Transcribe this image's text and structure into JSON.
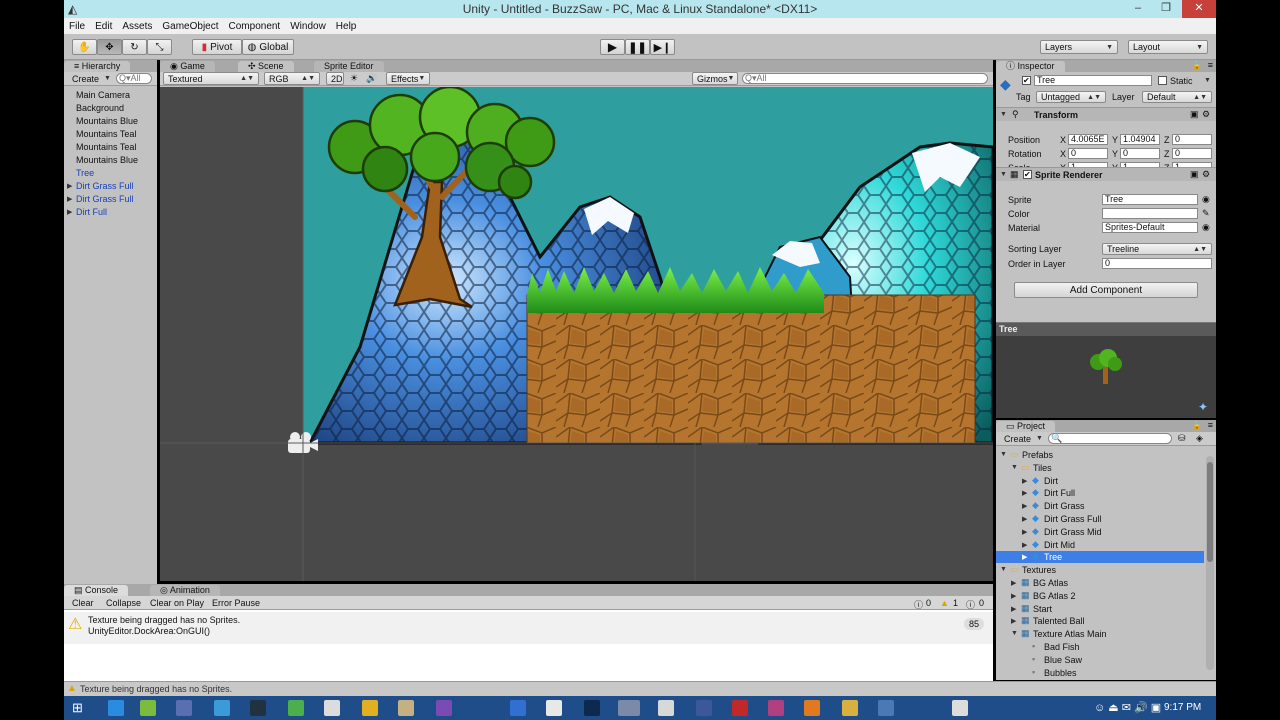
{
  "window": {
    "title": "Unity - Untitled - BuzzSaw - PC, Mac & Linux Standalone* <DX11>",
    "minimize": "–",
    "restore": "❐",
    "close": "✕"
  },
  "menu": [
    "File",
    "Edit",
    "Assets",
    "GameObject",
    "Component",
    "Window",
    "Help"
  ],
  "toolbar": {
    "pivot": "Pivot",
    "global": "Global",
    "layers": "Layers",
    "layout": "Layout"
  },
  "hierarchy": {
    "tab": "Hierarchy",
    "create": "Create",
    "search_placeholder": "Q▾All",
    "items": [
      "Main Camera",
      "Background",
      "Mountains Blue",
      "Mountains Teal",
      "Mountains Teal",
      "Mountains Blue",
      "Tree",
      "Dirt Grass Full",
      "Dirt Grass Full",
      "Dirt Full"
    ]
  },
  "scene_tabs": {
    "game": "Game",
    "scene": "Scene",
    "sprite_editor": "Sprite Editor"
  },
  "scene_bar": {
    "mode": "Textured",
    "channel": "RGB",
    "dim": "2D",
    "effects": "Effects",
    "gizmos": "Gizmos",
    "search": "Q▾All"
  },
  "inspector": {
    "tab": "Inspector",
    "name": "Tree",
    "static": "Static",
    "tag_label": "Tag",
    "tag": "Untagged",
    "layer_label": "Layer",
    "layer": "Default",
    "transform": {
      "title": "Transform",
      "position": {
        "label": "Position",
        "x": "4.0065E",
        "y": "1.04904",
        "z": "0"
      },
      "rotation": {
        "label": "Rotation",
        "x": "0",
        "y": "0",
        "z": "0"
      },
      "scale": {
        "label": "Scale",
        "x": "1",
        "y": "1",
        "z": "1"
      }
    },
    "sprite_renderer": {
      "title": "Sprite Renderer",
      "sprite_label": "Sprite",
      "sprite": "Tree",
      "color_label": "Color",
      "material_label": "Material",
      "material": "Sprites-Default",
      "sorting_layer_label": "Sorting Layer",
      "sorting_layer": "Treeline",
      "order_label": "Order in Layer",
      "order": "0"
    },
    "add_component": "Add Component",
    "preview_title": "Tree",
    "axis_x": "X",
    "axis_y": "Y",
    "axis_z": "Z"
  },
  "project": {
    "tab": "Project",
    "create": "Create",
    "tree": [
      {
        "label": "Prefabs",
        "indent": 0,
        "kind": "folder",
        "open": true
      },
      {
        "label": "Tiles",
        "indent": 1,
        "kind": "folder",
        "open": true
      },
      {
        "label": "Dirt",
        "indent": 2,
        "kind": "prefab"
      },
      {
        "label": "Dirt Full",
        "indent": 2,
        "kind": "prefab"
      },
      {
        "label": "Dirt Grass",
        "indent": 2,
        "kind": "prefab"
      },
      {
        "label": "Dirt Grass Full",
        "indent": 2,
        "kind": "prefab"
      },
      {
        "label": "Dirt Grass Mid",
        "indent": 2,
        "kind": "prefab"
      },
      {
        "label": "Dirt Mid",
        "indent": 2,
        "kind": "prefab"
      },
      {
        "label": "Tree",
        "indent": 2,
        "kind": "prefab",
        "selected": true
      },
      {
        "label": "Textures",
        "indent": 0,
        "kind": "folder",
        "open": true
      },
      {
        "label": "BG Atlas",
        "indent": 1,
        "kind": "texture"
      },
      {
        "label": "BG Atlas 2",
        "indent": 1,
        "kind": "texture"
      },
      {
        "label": "Start",
        "indent": 1,
        "kind": "texture"
      },
      {
        "label": "Talented Ball",
        "indent": 1,
        "kind": "texture"
      },
      {
        "label": "Texture Atlas Main",
        "indent": 1,
        "kind": "texture",
        "open": true
      },
      {
        "label": "Bad Fish",
        "indent": 2,
        "kind": "sprite"
      },
      {
        "label": "Blue Saw",
        "indent": 2,
        "kind": "sprite"
      },
      {
        "label": "Bubbles",
        "indent": 2,
        "kind": "sprite"
      }
    ]
  },
  "console": {
    "tab": "Console",
    "tab2": "Animation",
    "buttons": [
      "Clear",
      "Collapse",
      "Clear on Play",
      "Error Pause"
    ],
    "counts": {
      "info": "0",
      "warn": "1",
      "error": "0"
    },
    "message_line1": "Texture being dragged has no Sprites.",
    "message_line2": "UnityEditor.DockArea:OnGUI()",
    "message_count": "85",
    "status": "Texture being dragged has no Sprites."
  },
  "taskbar": {
    "time": "9:17 PM"
  },
  "colors": {
    "sky": "#2f9e9e",
    "selection": "#3d7fe6",
    "taskbar": "#1e4d8a",
    "panel": "#c2c2c2"
  }
}
